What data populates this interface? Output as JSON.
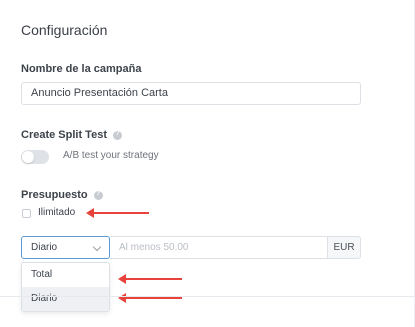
{
  "section": {
    "title": "Configuración"
  },
  "campaign": {
    "label": "Nombre de la campaña",
    "value": "Anuncio Presentación Carta"
  },
  "split_test": {
    "label": "Create Split Test",
    "toggle_text": "A/B test your strategy",
    "enabled": false
  },
  "budget": {
    "label": "Presupuesto",
    "unlimited_label": "Ilimitado",
    "unlimited_checked": false,
    "period_selected": "Diario",
    "amount_placeholder": "Al menos 50.00",
    "currency": "EUR",
    "period_options": [
      "Total",
      "Diario"
    ]
  },
  "annotations": {
    "arrow_color": "#e8433a"
  }
}
